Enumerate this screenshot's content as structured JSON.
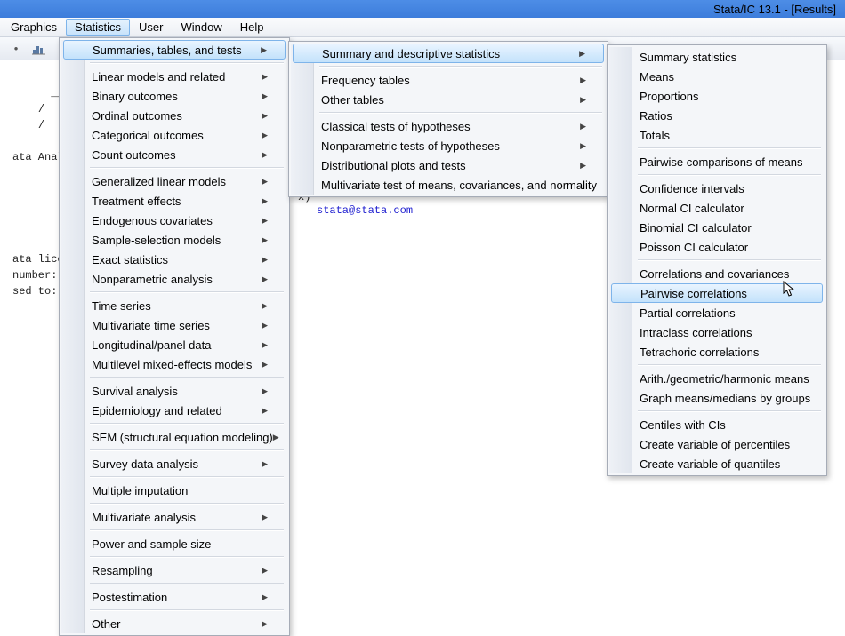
{
  "window": {
    "title": "Stata/IC 13.1 - [Results]"
  },
  "menubar": {
    "items": [
      "Graphics",
      "Statistics",
      "User",
      "Window",
      "Help"
    ],
    "active_index": 1
  },
  "toolbar": {
    "buttons": [
      "dot-icon",
      "bar-chart-icon"
    ]
  },
  "content": {
    "ascii_top": "___",
    "ascii_line2": "/   /",
    "ascii_line3": "/   /",
    "label_analysis": "ata Anal",
    "email_suffix": "x)",
    "email": "stata@stata.com",
    "lic1": "ata lice",
    "lic2": "number:",
    "lic3": "sed to:"
  },
  "menu1": {
    "items": [
      {
        "label": "Summaries, tables, and tests",
        "sub": true,
        "hl": true
      },
      {
        "sep": true
      },
      {
        "label": "Linear models and related",
        "sub": true
      },
      {
        "label": "Binary outcomes",
        "sub": true
      },
      {
        "label": "Ordinal outcomes",
        "sub": true
      },
      {
        "label": "Categorical outcomes",
        "sub": true
      },
      {
        "label": "Count outcomes",
        "sub": true
      },
      {
        "sep": true
      },
      {
        "label": "Generalized linear models",
        "sub": true
      },
      {
        "label": "Treatment effects",
        "sub": true
      },
      {
        "label": "Endogenous covariates",
        "sub": true
      },
      {
        "label": "Sample-selection models",
        "sub": true
      },
      {
        "label": "Exact statistics",
        "sub": true
      },
      {
        "label": "Nonparametric analysis",
        "sub": true
      },
      {
        "sep": true
      },
      {
        "label": "Time series",
        "sub": true
      },
      {
        "label": "Multivariate time series",
        "sub": true
      },
      {
        "label": "Longitudinal/panel data",
        "sub": true
      },
      {
        "label": "Multilevel mixed-effects models",
        "sub": true
      },
      {
        "sep": true
      },
      {
        "label": "Survival analysis",
        "sub": true
      },
      {
        "label": "Epidemiology and related",
        "sub": true
      },
      {
        "sep": true
      },
      {
        "label": "SEM (structural equation modeling)",
        "sub": true
      },
      {
        "sep": true
      },
      {
        "label": "Survey data analysis",
        "sub": true
      },
      {
        "sep": true
      },
      {
        "label": "Multiple imputation"
      },
      {
        "sep": true
      },
      {
        "label": "Multivariate analysis",
        "sub": true
      },
      {
        "sep": true
      },
      {
        "label": "Power and sample size"
      },
      {
        "sep": true
      },
      {
        "label": "Resampling",
        "sub": true
      },
      {
        "sep": true
      },
      {
        "label": "Postestimation",
        "sub": true
      },
      {
        "sep": true
      },
      {
        "label": "Other",
        "sub": true
      }
    ]
  },
  "menu2": {
    "items": [
      {
        "label": "Summary and descriptive statistics",
        "sub": true,
        "hl": true
      },
      {
        "sep": true
      },
      {
        "label": "Frequency tables",
        "sub": true
      },
      {
        "label": "Other tables",
        "sub": true
      },
      {
        "sep": true
      },
      {
        "label": "Classical tests of hypotheses",
        "sub": true
      },
      {
        "label": "Nonparametric tests of hypotheses",
        "sub": true
      },
      {
        "label": "Distributional plots and tests",
        "sub": true
      },
      {
        "label": "Multivariate test of means, covariances, and normality"
      }
    ]
  },
  "menu3": {
    "items": [
      {
        "label": "Summary statistics"
      },
      {
        "label": "Means"
      },
      {
        "label": "Proportions"
      },
      {
        "label": "Ratios"
      },
      {
        "label": "Totals"
      },
      {
        "sep": true
      },
      {
        "label": "Pairwise comparisons of means"
      },
      {
        "sep": true
      },
      {
        "label": "Confidence intervals"
      },
      {
        "label": "Normal CI calculator"
      },
      {
        "label": "Binomial CI calculator"
      },
      {
        "label": "Poisson CI calculator"
      },
      {
        "sep": true
      },
      {
        "label": "Correlations and covariances"
      },
      {
        "label": "Pairwise correlations",
        "hl": true
      },
      {
        "label": "Partial correlations"
      },
      {
        "label": "Intraclass correlations"
      },
      {
        "label": "Tetrachoric correlations"
      },
      {
        "sep": true
      },
      {
        "label": "Arith./geometric/harmonic means"
      },
      {
        "label": "Graph means/medians by groups"
      },
      {
        "sep": true
      },
      {
        "label": "Centiles with CIs"
      },
      {
        "label": "Create variable of percentiles"
      },
      {
        "label": "Create variable of quantiles"
      }
    ]
  }
}
